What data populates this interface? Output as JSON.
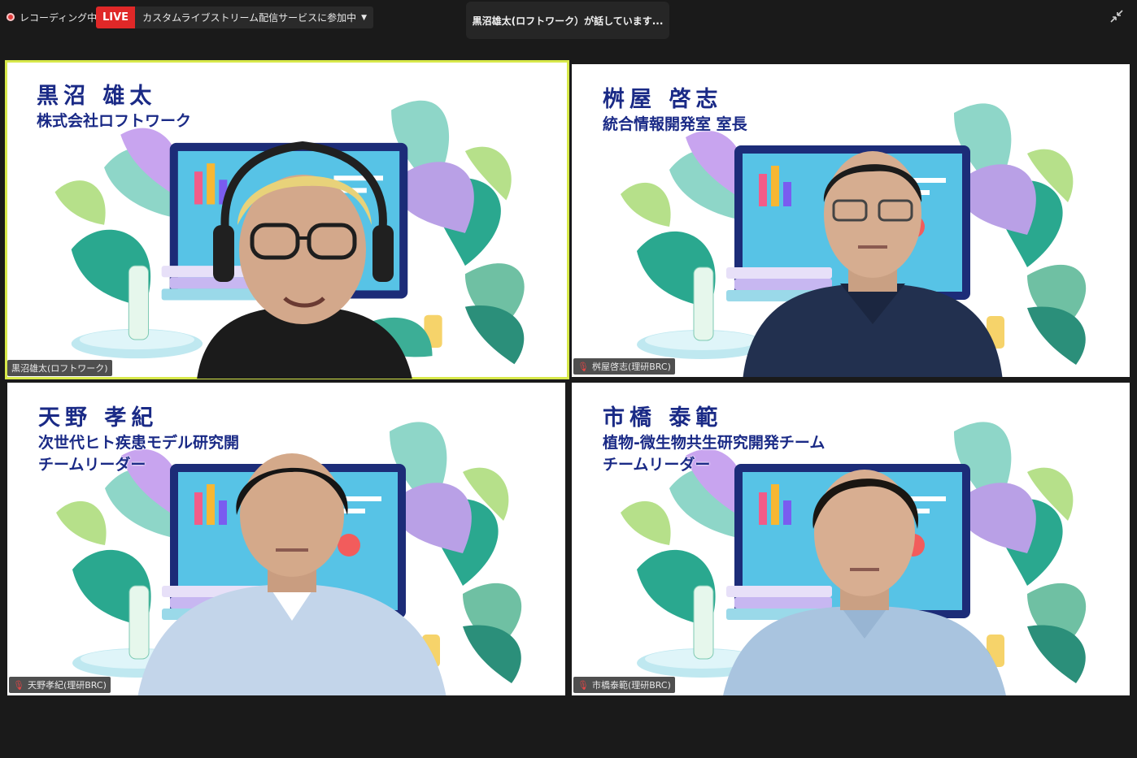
{
  "top_bar": {
    "recording_label": "レコーディング中",
    "live_badge": "LIVE",
    "live_status": "カスタムライブストリーム配信サービスに参加中",
    "speaking_indicator": "黒沼雄太(ロフトワーク）が話しています..."
  },
  "participants": [
    {
      "title_name": "黒沼 雄太",
      "title_sub": "株式会社ロフトワーク",
      "title_sub2": "",
      "name_tag": "黒沼雄太(ロフトワーク)",
      "active_speaker": true,
      "muted": false
    },
    {
      "title_name": "桝屋 啓志",
      "title_sub": "統合情報開発室 室長",
      "title_sub2": "",
      "name_tag": "桝屋啓志(理研BRC)",
      "active_speaker": false,
      "muted": true
    },
    {
      "title_name": "天野 孝紀",
      "title_sub": "次世代ヒト疾患モデル研究開",
      "title_sub2": "チームリーダー",
      "name_tag": "天野孝紀(理研BRC)",
      "active_speaker": false,
      "muted": true
    },
    {
      "title_name": "市橋 泰範",
      "title_sub": "植物-微生物共生研究開発チーム",
      "title_sub2": "チームリーダー",
      "name_tag": "市橋泰範(理研BRC)",
      "active_speaker": false,
      "muted": true
    }
  ],
  "colors": {
    "active_border": "#d7e84a",
    "live_red": "#e02828",
    "title_blue": "#1a2a86",
    "mute_red": "#e34545"
  },
  "icons": {
    "recording": "recording-dot-icon",
    "dropdown": "chevron-down-icon",
    "exit_fullscreen": "exit-fullscreen-icon",
    "mic_off": "mic-off-icon"
  }
}
